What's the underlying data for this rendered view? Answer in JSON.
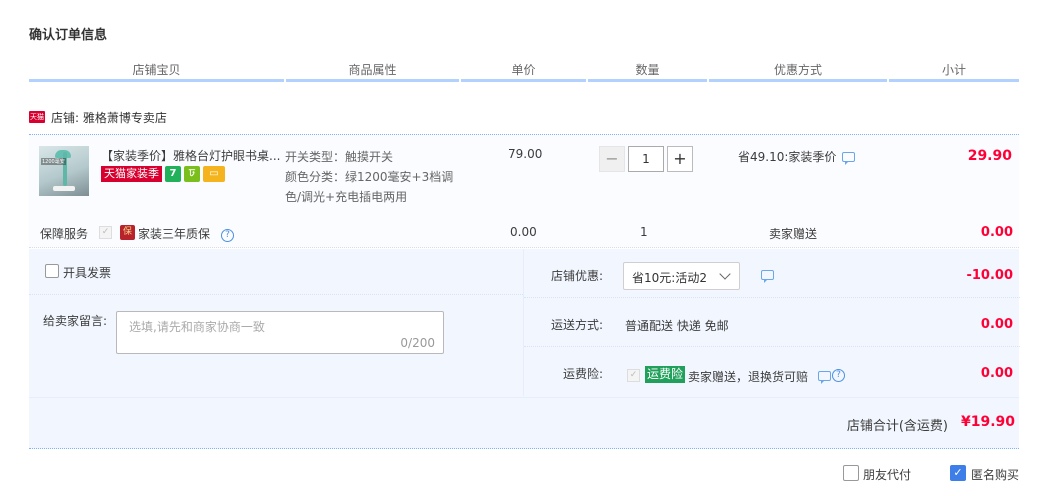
{
  "page_title": "确认订单信息",
  "columns": [
    "店铺宝贝",
    "商品属性",
    "单价",
    "数量",
    "优惠方式",
    "小计"
  ],
  "shop": {
    "badge": "天猫",
    "label": "店铺: 雅格萧博专卖店"
  },
  "item": {
    "name": "【家装季价】雅格台灯护眼书桌...",
    "promo_tag": "天猫家装季",
    "promo_icon_1": "7",
    "promo_icon_2": "ঢ",
    "thumb_tag": "1200毫安",
    "attr_line_1": "开关类型：触摸开关",
    "attr_line_2": "颜色分类：绿1200毫安+3档调",
    "attr_line_3": "色/调光+充电插电两用",
    "price": "79.00",
    "quantity": "1",
    "minus": "−",
    "plus": "+",
    "discount": "省49.10:家装季价",
    "subtotal": "29.90"
  },
  "service": {
    "label": "保障服务",
    "icon_text": "保",
    "name": "家装三年质保",
    "help": "?",
    "price": "0.00",
    "quantity": "1",
    "discount": "卖家赠送",
    "subtotal": "0.00"
  },
  "order": {
    "invoice_label": "开具发票",
    "message_label": "给卖家留言:",
    "message_placeholder": "选填,请先和商家协商一致",
    "message_count": "0/200",
    "shop_discount_label": "店铺优惠:",
    "shop_discount_value": "省10元:活动2",
    "shop_discount_amount": "-10.00",
    "shipping_label": "运送方式:",
    "shipping_value": "普通配送 快递 免邮",
    "shipping_amount": "0.00",
    "insurance_label": "运费险:",
    "insurance_tag": "运费险",
    "insurance_text": "卖家赠送，退换货可赔",
    "insurance_amount": "0.00",
    "total_label": "店铺合计(含运费)",
    "total_amount": "¥19.90"
  },
  "footer": {
    "friend_pay": "朋友代付",
    "anonymous": "匿名购买",
    "check_mark": "✓"
  }
}
